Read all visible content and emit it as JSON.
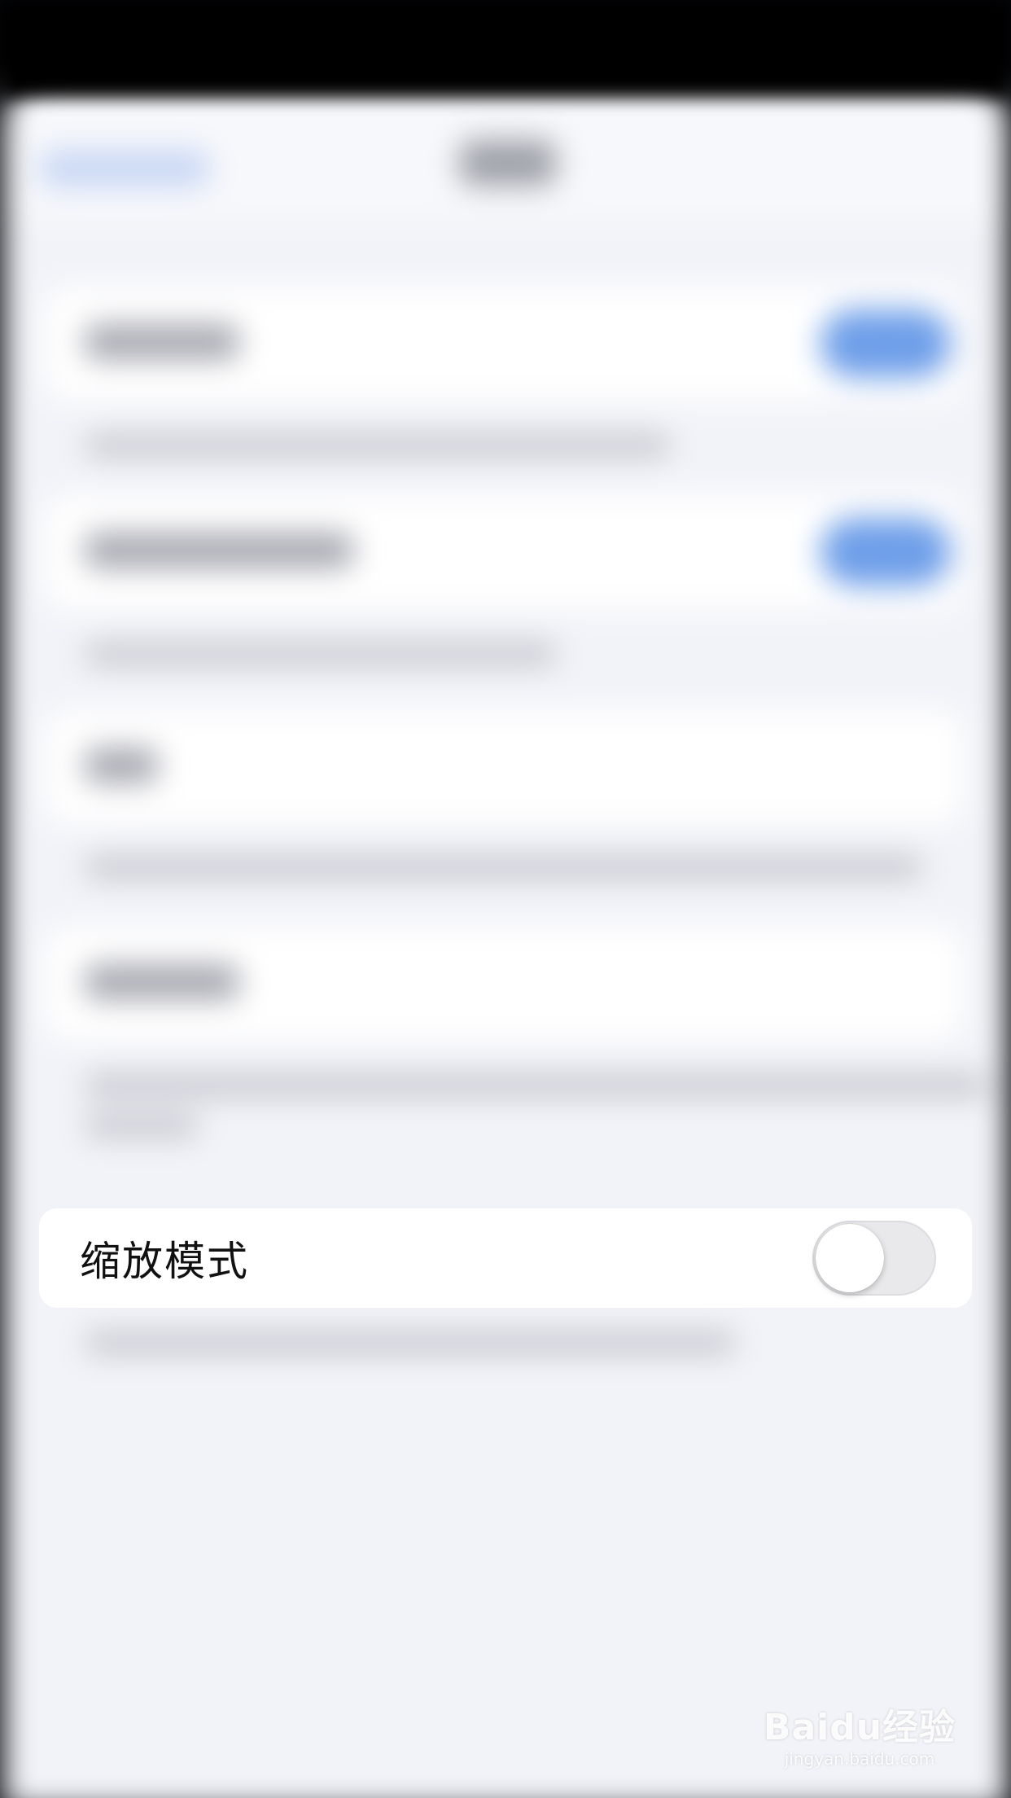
{
  "focused_setting": {
    "label": "缩放模式",
    "toggle_on": false
  },
  "watermark": {
    "logo_text": "Baidu经验",
    "subtext": "jingyan.baidu.com"
  },
  "colors": {
    "toggle_off_track": "#e9e9eb",
    "toggle_on_track_blurred": "#6f9fe9",
    "background": "#f2f3f8",
    "row_background": "#ffffff"
  }
}
